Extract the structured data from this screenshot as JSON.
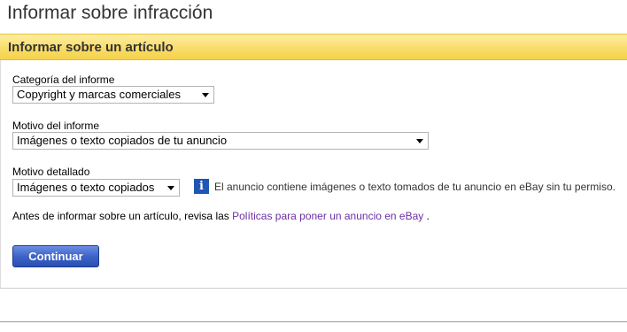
{
  "page": {
    "title": "Informar sobre infracción"
  },
  "section": {
    "title": "Informar sobre un artículo"
  },
  "form": {
    "report_category": {
      "label": "Categoría del informe",
      "value": "Copyright y marcas comerciales"
    },
    "report_reason": {
      "label": "Motivo del informe",
      "value": "Imágenes o texto copiados de tu anuncio"
    },
    "detailed_reason": {
      "label": "Motivo detallado",
      "value": "Imágenes o texto copiados",
      "info_icon": "info-icon",
      "info_text": "El anuncio contiene imágenes o texto tomados de tu anuncio en eBay sin tu permiso."
    }
  },
  "policy": {
    "prefix": "Antes de informar sobre un artículo, revisa las ",
    "link_text": "Políticas para poner un anuncio en eBay",
    "suffix": " ."
  },
  "actions": {
    "continue_label": "Continuar"
  },
  "colors": {
    "header_yellow": "#f9dd6b",
    "button_blue": "#3e63c8",
    "link_purple": "#6b2fa5",
    "info_icon_blue": "#1f55b5"
  }
}
